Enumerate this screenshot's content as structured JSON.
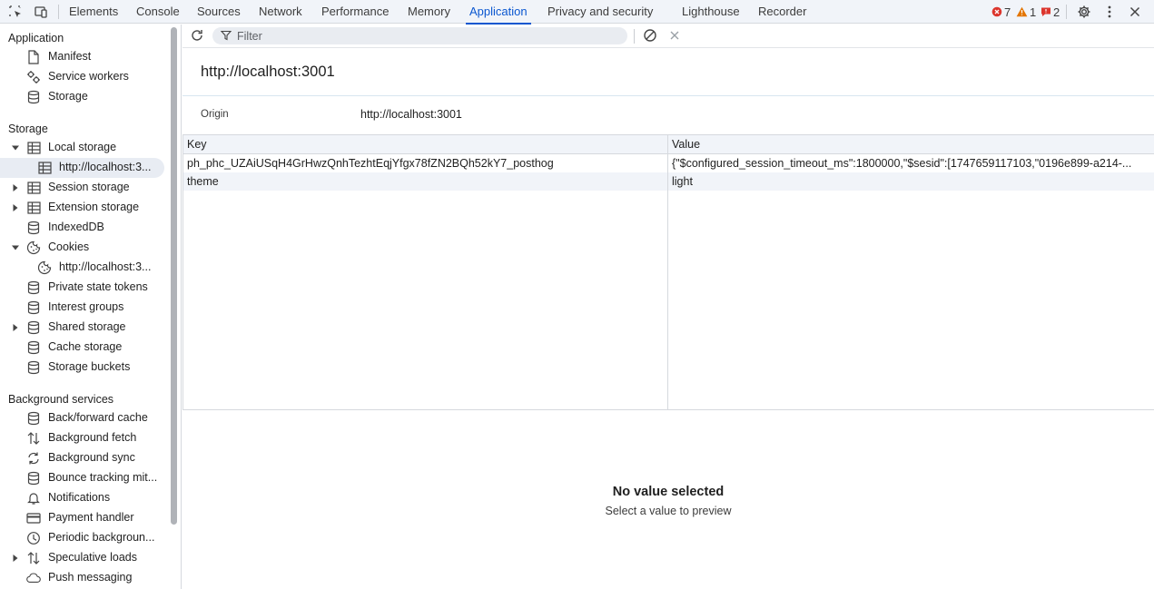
{
  "tabs": [
    "Elements",
    "Console",
    "Sources",
    "Network",
    "Performance",
    "Memory",
    "Application",
    "Privacy and security",
    "Lighthouse",
    "Recorder"
  ],
  "active_tab": "Application",
  "badges": {
    "errors": "7",
    "warnings": "1",
    "issues": "2"
  },
  "colors": {
    "accent": "#0b57d0",
    "error": "#dc362e",
    "warning": "#e37400",
    "issue": "#dc362e"
  },
  "sidebar": {
    "application": {
      "title": "Application",
      "items": [
        {
          "label": "Manifest",
          "icon": "document-icon"
        },
        {
          "label": "Service workers",
          "icon": "gears-icon"
        },
        {
          "label": "Storage",
          "icon": "database-icon"
        }
      ]
    },
    "storage": {
      "title": "Storage",
      "items": [
        {
          "label": "Local storage",
          "icon": "table-icon"
        },
        {
          "label": "http://localhost:3...",
          "icon": "table-icon"
        },
        {
          "label": "Session storage",
          "icon": "table-icon"
        },
        {
          "label": "Extension storage",
          "icon": "table-icon"
        },
        {
          "label": "IndexedDB",
          "icon": "database-icon"
        },
        {
          "label": "Cookies",
          "icon": "cookie-icon"
        },
        {
          "label": "http://localhost:3...",
          "icon": "cookie-icon"
        },
        {
          "label": "Private state tokens",
          "icon": "database-icon"
        },
        {
          "label": "Interest groups",
          "icon": "database-icon"
        },
        {
          "label": "Shared storage",
          "icon": "database-icon"
        },
        {
          "label": "Cache storage",
          "icon": "database-icon"
        },
        {
          "label": "Storage buckets",
          "icon": "database-icon"
        }
      ]
    },
    "background": {
      "title": "Background services",
      "items": [
        {
          "label": "Back/forward cache",
          "icon": "database-icon"
        },
        {
          "label": "Background fetch",
          "icon": "up-down-arrows-icon"
        },
        {
          "label": "Background sync",
          "icon": "sync-icon"
        },
        {
          "label": "Bounce tracking mit...",
          "icon": "database-icon"
        },
        {
          "label": "Notifications",
          "icon": "bell-icon"
        },
        {
          "label": "Payment handler",
          "icon": "card-icon"
        },
        {
          "label": "Periodic backgroun...",
          "icon": "clock-icon"
        },
        {
          "label": "Speculative loads",
          "icon": "up-down-arrows-icon"
        },
        {
          "label": "Push messaging",
          "icon": "cloud-icon"
        }
      ]
    }
  },
  "toolbar": {
    "filter_placeholder": "Filter"
  },
  "main": {
    "title": "http://localhost:3001",
    "origin_label": "Origin",
    "origin_value": "http://localhost:3001",
    "columns": [
      "Key",
      "Value"
    ],
    "rows": [
      {
        "key": "ph_phc_UZAiUSqH4GrHwzQnhTezhtEqjYfgx78fZN2BQh52kY7_posthog",
        "value": "{\"$configured_session_timeout_ms\":1800000,\"$sesid\":[1747659117103,\"0196e899-a214-..."
      },
      {
        "key": "theme",
        "value": "light"
      }
    ],
    "empty_title": "No value selected",
    "empty_subtitle": "Select a value to preview"
  }
}
